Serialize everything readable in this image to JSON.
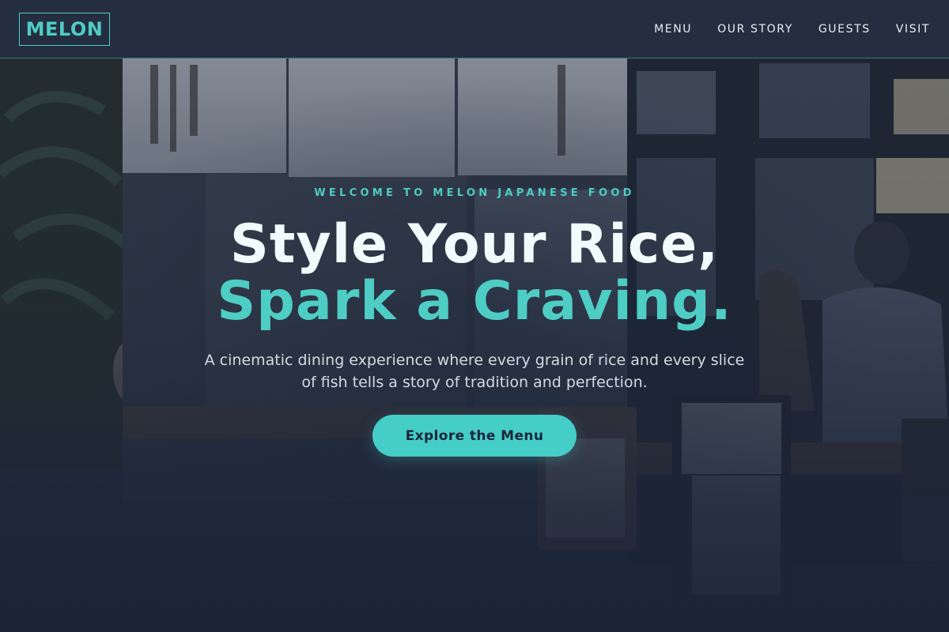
{
  "brand": {
    "logo_text": "MELON",
    "accent_color": "#4ecdc4"
  },
  "nav": {
    "items": [
      {
        "label": "MENU"
      },
      {
        "label": "OUR STORY"
      },
      {
        "label": "GUESTS"
      },
      {
        "label": "VISIT"
      }
    ]
  },
  "hero": {
    "eyebrow": "WELCOME TO MELON JAPANESE FOOD",
    "headline_line1": "Style Your Rice,",
    "headline_line2": "Spark a Craving.",
    "subtitle": "A cinematic dining experience where every grain of rice and every slice of fish tells a story of tradition and perfection.",
    "cta_label": "Explore the Menu",
    "background": "restaurant storefront photo with noren curtains"
  }
}
